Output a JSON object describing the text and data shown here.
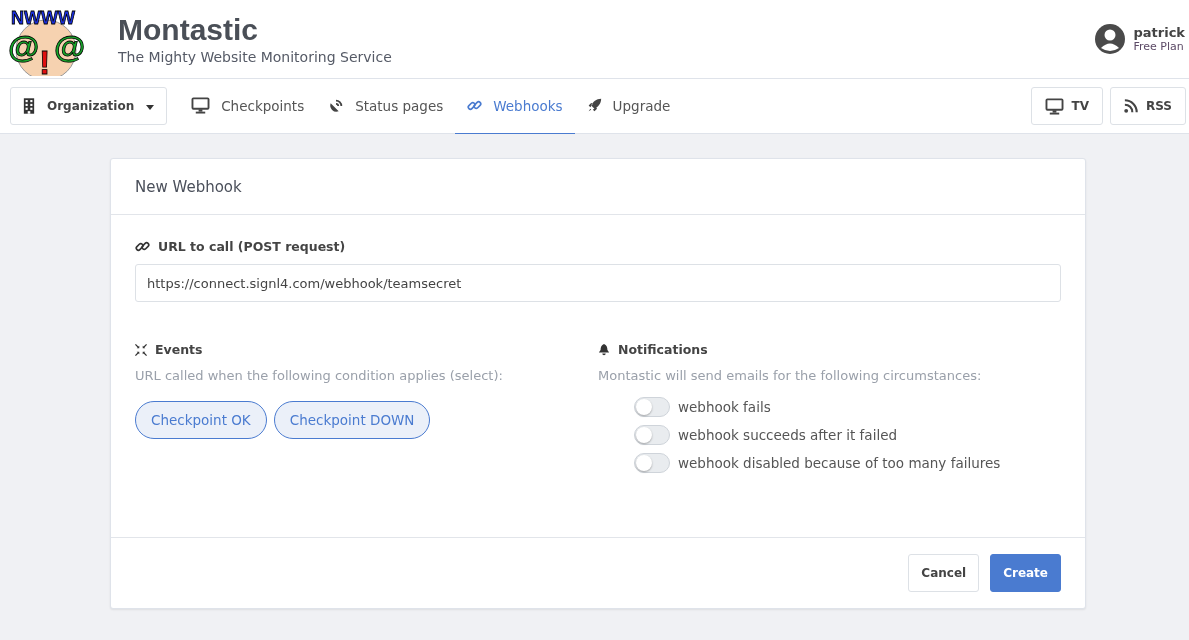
{
  "logo": {
    "top": "NWWW",
    "left": "@",
    "middle": "!",
    "right": "@"
  },
  "brand": {
    "title": "Montastic",
    "subtitle": "The Mighty Website Monitoring Service"
  },
  "user": {
    "name": "patrick",
    "plan": "Free Plan"
  },
  "org_menu": {
    "label": "Organization"
  },
  "nav": [
    {
      "label": "Checkpoints",
      "kind": "monitor",
      "selected": false
    },
    {
      "label": "Status pages",
      "kind": "satellite",
      "selected": false
    },
    {
      "label": "Webhooks",
      "kind": "link",
      "selected": true
    },
    {
      "label": "Upgrade",
      "kind": "rocket",
      "selected": false
    }
  ],
  "nav_buttons": [
    {
      "label": "TV",
      "kind": "monitor"
    },
    {
      "label": "RSS",
      "kind": "rss"
    }
  ],
  "card": {
    "title": "New Webhook",
    "url_label": "URL to call (POST request)",
    "url_value": "https://connect.signl4.com/webhook/teamsecret",
    "events": {
      "title": "Events",
      "hint": "URL called when the following condition applies (select):",
      "options": [
        {
          "label": "Checkpoint OK",
          "selected": false
        },
        {
          "label": "Checkpoint DOWN",
          "selected": false
        }
      ]
    },
    "notifications": {
      "title": "Notifications",
      "hint": "Montastic will send emails for the following circumstances:",
      "toggles": [
        {
          "label": "webhook fails",
          "on": false
        },
        {
          "label": "webhook succeeds after it failed",
          "on": false
        },
        {
          "label": "webhook disabled because of too many failures",
          "on": false
        }
      ]
    },
    "buttons": [
      {
        "label": "Cancel",
        "kind": "secondary"
      },
      {
        "label": "Create",
        "kind": "primary"
      }
    ]
  }
}
